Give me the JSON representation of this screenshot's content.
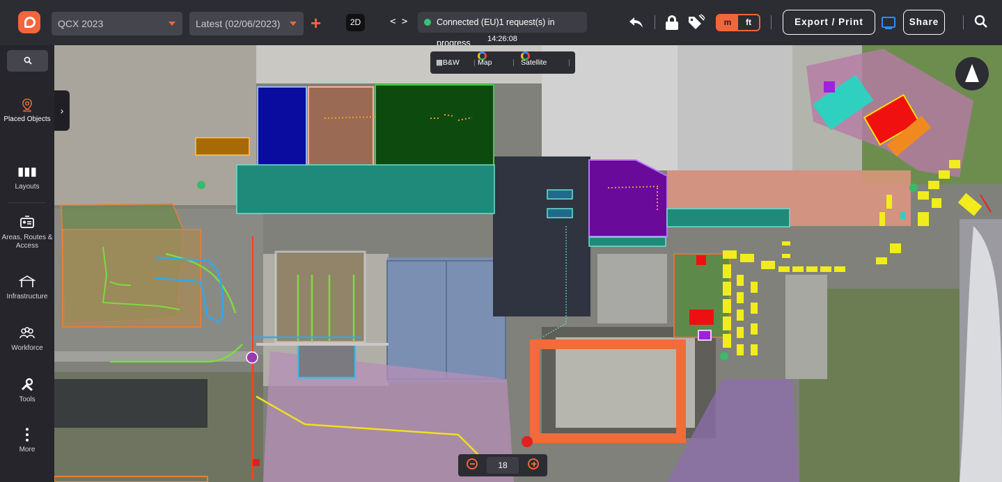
{
  "topbar": {
    "project_select": "QCX 2023",
    "version_select": "Latest (02/06/2023)",
    "view_mode": "2D",
    "code_toggle": "< >",
    "status_text": "Connected (EU)1 request(s) in progress",
    "clock": "14:26:08",
    "units": {
      "metric": "m",
      "imperial": "ft",
      "selected": "m"
    },
    "export_label": "Export / Print",
    "share_label": "Share"
  },
  "sidebar": {
    "items": [
      {
        "label": "Placed Objects",
        "icon": "map-pin-icon",
        "active": true
      },
      {
        "label": "Layouts",
        "icon": "layouts-icon"
      },
      {
        "label": "Areas, Routes & Access",
        "icon": "id-card-icon"
      },
      {
        "label": "Infrastructure",
        "icon": "tent-icon"
      },
      {
        "label": "Workforce",
        "icon": "people-icon"
      },
      {
        "label": "Tools",
        "icon": "tools-icon"
      },
      {
        "label": "More",
        "icon": "dots-vertical-icon"
      }
    ]
  },
  "map_types": {
    "bw": "B&W",
    "map": "Map",
    "satellite": "Satellite"
  },
  "zoom": {
    "level": "18"
  },
  "colors": {
    "accent": "#f2663b",
    "connected": "#3dbf7a",
    "monitor": "#2d8cff"
  }
}
